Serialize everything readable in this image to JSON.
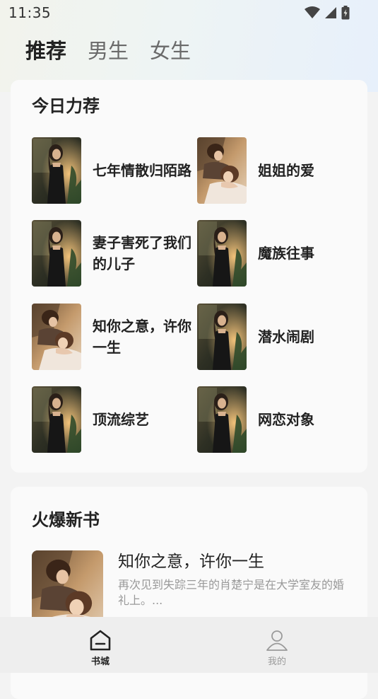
{
  "status_bar": {
    "time": "11:35"
  },
  "tabs": [
    {
      "label": "推荐",
      "active": true
    },
    {
      "label": "男生",
      "active": false
    },
    {
      "label": "女生",
      "active": false
    }
  ],
  "recommend": {
    "title": "今日力荐",
    "books": [
      {
        "title": "七年情散归陌路",
        "cover": "woman-dress"
      },
      {
        "title": "姐姐的爱",
        "cover": "couple"
      },
      {
        "title": "妻子害死了我们的儿子",
        "cover": "woman-dress"
      },
      {
        "title": "魔族往事",
        "cover": "woman-dress"
      },
      {
        "title": "知你之意，许你一生",
        "cover": "couple"
      },
      {
        "title": "潜水闹剧",
        "cover": "woman-dress"
      },
      {
        "title": "顶流综艺",
        "cover": "woman-dress"
      },
      {
        "title": "网恋对象",
        "cover": "woman-dress"
      }
    ]
  },
  "new_books": {
    "title": "火爆新书",
    "items": [
      {
        "title": "知你之意，许你一生",
        "desc": "再次见到失踪三年的肖楚宁是在大学室友的婚礼上。...",
        "cover": "couple"
      }
    ]
  },
  "bottom_nav": [
    {
      "label": "书城",
      "icon": "home-icon",
      "active": true
    },
    {
      "label": "我的",
      "icon": "user-icon",
      "active": false
    }
  ],
  "colors": {
    "active_text": "#222222",
    "inactive_text": "#6a6a6a",
    "nav_inactive": "#9a9a9a"
  }
}
